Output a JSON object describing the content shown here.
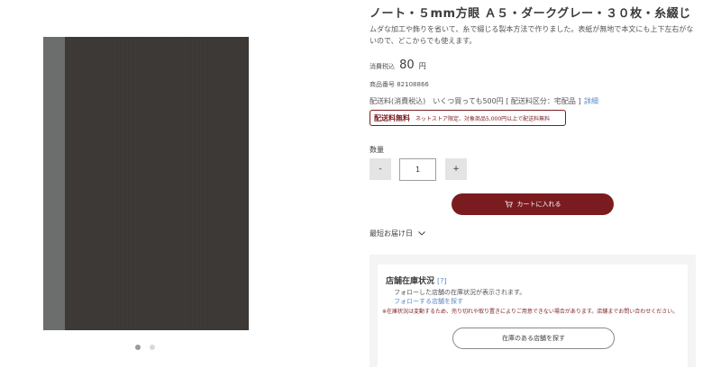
{
  "product": {
    "title": "ノート・５mm方眼 Ａ５・ダークグレー・３０枚・糸綴じ",
    "description": "ムダな加工や飾りを省いて、糸で綴じる製本方法で作りました。表紙が無地で本文にも上下左右がないので、どこからでも使えます。",
    "price_prefix": "消費税込",
    "price": "80",
    "price_unit": "円",
    "sku": "商品番号 82108866"
  },
  "shipping": {
    "text": "配送料(消費税込)　いくつ買っても500円 [ 配送料区分：宅配品 ]",
    "details_link": "詳細",
    "free_title": "配送料無料",
    "free_note": "ネットストア限定、対象商品5,000円以上で配送料無料"
  },
  "quantity": {
    "label": "数量",
    "minus": "-",
    "value": "1",
    "plus": "+"
  },
  "cart": {
    "icon": "cart-icon",
    "label": "カートに入れる"
  },
  "delivery": {
    "label": "最短お届け日",
    "icon": "chevron-down-icon"
  },
  "stock": {
    "title": "店舗在庫状況",
    "help": "[?]",
    "text": "フォローした店舗の在庫状況が表示されます。",
    "follow_link": "フォローする店舗を探す",
    "note": "※在庫状況は変動するため、売り切れや取り置きによりご用意できない場合があります。店舗までお問い合わせください。",
    "button": "在庫のある店舗を探す"
  },
  "gallery": {
    "dots": 2,
    "active_index": 0
  },
  "colors": {
    "accent": "#7a1c1f",
    "link": "#5b8ac6",
    "notebook_cover": "#3b3835",
    "notebook_spine": "#6b6e6c"
  }
}
